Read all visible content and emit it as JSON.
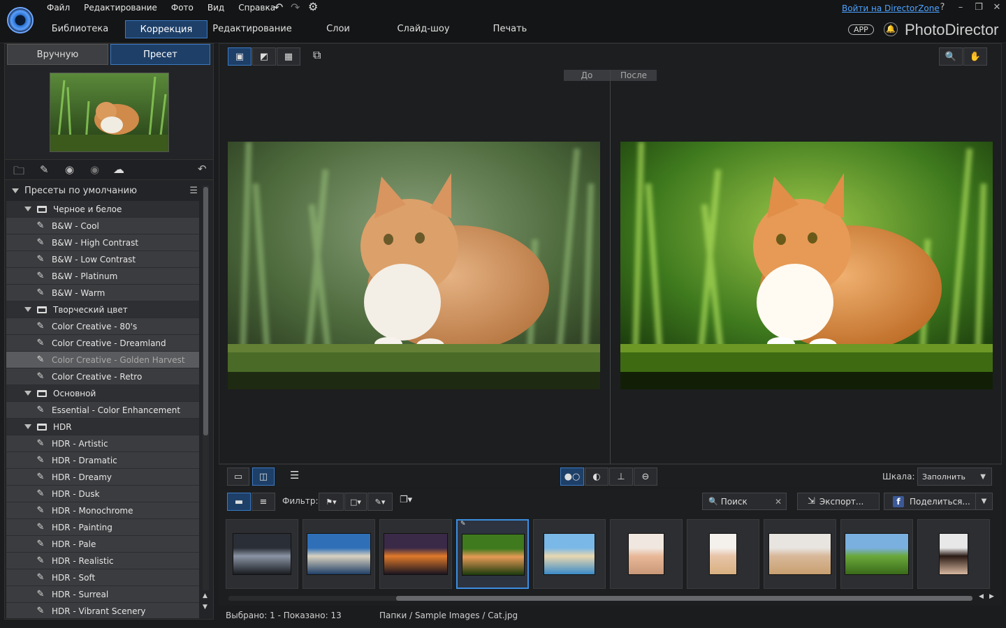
{
  "menu": [
    "Файл",
    "Редактирование",
    "Фото",
    "Вид",
    "Справка"
  ],
  "directorzone_link": "Войти на DirectorZone",
  "help": "?",
  "main_tabs": [
    "Библиотека",
    "Коррекция",
    "Редактирование",
    "Слои",
    "Слайд-шоу",
    "Печать"
  ],
  "app_badge": "APP",
  "app_name": "PhotoDirector",
  "sub_tabs": [
    "Вручную",
    "Пресет"
  ],
  "presets_header": "Пресеты по умолчанию",
  "tree": [
    {
      "type": "folder",
      "label": "Черное и белое"
    },
    {
      "type": "preset",
      "label": "B&W - Cool"
    },
    {
      "type": "preset",
      "label": "B&W - High Contrast"
    },
    {
      "type": "preset",
      "label": "B&W - Low Contrast"
    },
    {
      "type": "preset",
      "label": "B&W - Platinum"
    },
    {
      "type": "preset",
      "label": "B&W - Warm"
    },
    {
      "type": "folder",
      "label": "Творческий цвет"
    },
    {
      "type": "preset",
      "label": "Color Creative - 80's"
    },
    {
      "type": "preset",
      "label": "Color Creative - Dreamland"
    },
    {
      "type": "preset",
      "label": "Color Creative - Golden Harvest",
      "selected": true
    },
    {
      "type": "preset",
      "label": "Color Creative - Retro"
    },
    {
      "type": "folder",
      "label": "Основной"
    },
    {
      "type": "preset",
      "label": "Essential - Color Enhancement"
    },
    {
      "type": "folder",
      "label": "HDR"
    },
    {
      "type": "preset",
      "label": "HDR - Artistic"
    },
    {
      "type": "preset",
      "label": "HDR - Dramatic"
    },
    {
      "type": "preset",
      "label": "HDR - Dreamy"
    },
    {
      "type": "preset",
      "label": "HDR - Dusk"
    },
    {
      "type": "preset",
      "label": "HDR - Monochrome"
    },
    {
      "type": "preset",
      "label": "HDR - Painting"
    },
    {
      "type": "preset",
      "label": "HDR - Pale"
    },
    {
      "type": "preset",
      "label": "HDR - Realistic"
    },
    {
      "type": "preset",
      "label": "HDR - Soft"
    },
    {
      "type": "preset",
      "label": "HDR - Surreal"
    },
    {
      "type": "preset",
      "label": "HDR - Vibrant Scenery"
    }
  ],
  "before_label": "До",
  "after_label": "После",
  "scale_label": "Шкала:",
  "scale_value": "Заполнить",
  "filter_label": "Фильтр:",
  "search_placeholder": "Поиск",
  "export_label": "Экспорт...",
  "share_label": "Поделиться...",
  "status_selected": "Выбрано: 1 - Показано: 13",
  "status_path": "Папки / Sample Images / Cat.jpg",
  "thumbnails": [
    "mountain-lake-dark",
    "mountain-lake-blue",
    "sunset-clouds",
    "cat-grass",
    "beach-kids",
    "woman-smiling",
    "woman-portrait",
    "woman-relaxing",
    "green-hills",
    "woman-dark-hair"
  ],
  "colors": {
    "accent": "#3c7bc4",
    "active_tab": "#1d3f68",
    "link": "#4da3ff"
  }
}
